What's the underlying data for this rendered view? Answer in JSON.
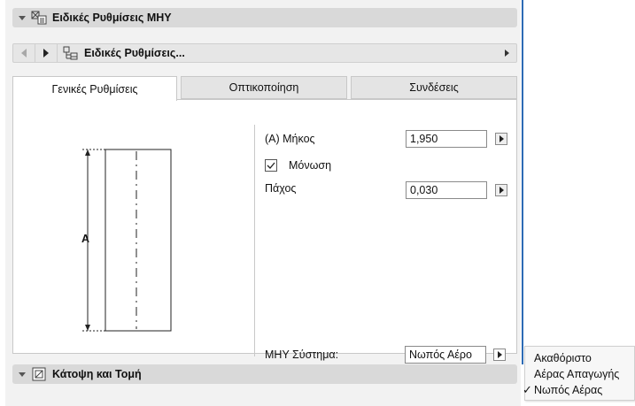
{
  "header": {
    "title": "Ειδικές Ρυθμίσεις ΜΗΥ"
  },
  "navbar": {
    "label": "Ειδικές Ρυθμίσεις..."
  },
  "tabs": [
    {
      "label": "Γενικές Ρυθμίσεις",
      "active": true
    },
    {
      "label": "Οπτικοποίηση",
      "active": false
    },
    {
      "label": "Συνδέσεις",
      "active": false
    }
  ],
  "preview": {
    "dimension_label": "A"
  },
  "fields": {
    "length_label": "(A) Μήκος",
    "length_value": "1,950",
    "insulation_label": "Μόνωση",
    "insulation_checked": true,
    "thickness_label": "Πάχος",
    "thickness_value": "0,030",
    "system_label": "ΜΗΥ Σύστημα:",
    "system_value": "Νωπός Αέρο"
  },
  "dropdown": {
    "options": [
      "Ακαθόριστο",
      "Αέρας Απαγωγής",
      "Νωπός Αέρας"
    ],
    "selected": "Νωπός Αέρας"
  },
  "footer_section": {
    "title": "Κάτοψη και Τομή"
  },
  "colors": {
    "accent_line": "#2d6bb5",
    "header_bg": "#d9d9d9"
  }
}
